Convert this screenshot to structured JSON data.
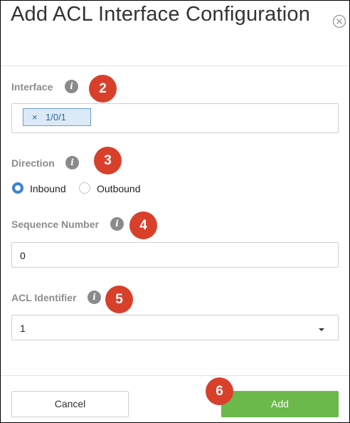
{
  "dialog": {
    "title": "Add ACL Interface Configuration",
    "close_icon": "close-circle-icon"
  },
  "interface": {
    "label": "Interface",
    "info_icon": "i",
    "badge": "2",
    "chips": [
      {
        "remove": "×",
        "value": "1/0/1"
      }
    ]
  },
  "direction": {
    "label": "Direction",
    "info_icon": "i",
    "badge": "3",
    "options": [
      {
        "label": "Inbound",
        "selected": true
      },
      {
        "label": "Outbound",
        "selected": false
      }
    ]
  },
  "sequence_number": {
    "label": "Sequence Number",
    "info_icon": "i",
    "badge": "4",
    "value": "0"
  },
  "acl_identifier": {
    "label": "ACL Identifier",
    "info_icon": "i",
    "badge": "5",
    "value": "1"
  },
  "footer": {
    "cancel_label": "Cancel",
    "add_label": "Add",
    "badge": "6",
    "add_color": "#6bb94a"
  }
}
